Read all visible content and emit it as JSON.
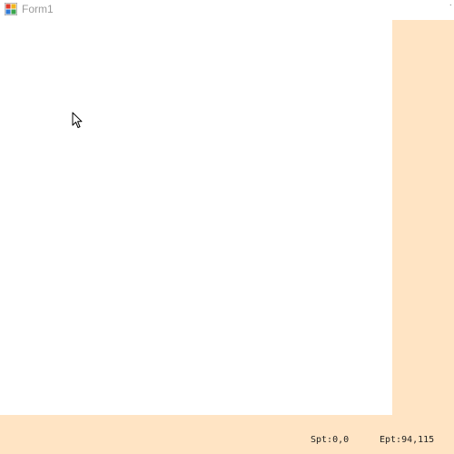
{
  "window": {
    "title": "Form1",
    "icon": "winforms-app-icon"
  },
  "canvas": {
    "background": "#ffffff",
    "panel_color": "#ffe4c4"
  },
  "status": {
    "start_point": "Spt:0,0",
    "end_point": "Ept:94,115"
  },
  "cursor": {
    "icon": "mouse-pointer-arrow-icon"
  }
}
